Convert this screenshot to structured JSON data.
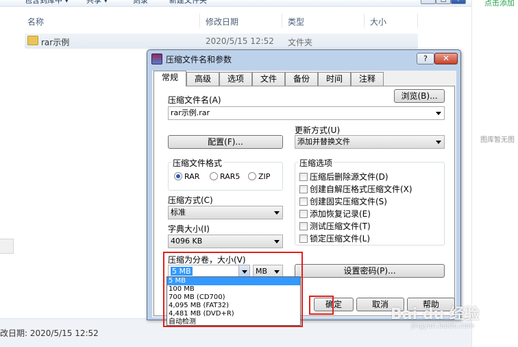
{
  "explorer": {
    "toolbar": [
      "包含到库中 ▾",
      "共享 ▾",
      "刻录",
      "新建文件夹"
    ],
    "window_controls": [
      "─",
      "□",
      "?"
    ],
    "columns": [
      "名称",
      "修改日期",
      "类型",
      "大小"
    ],
    "file": {
      "name": "rar示例",
      "modified": "2020/5/15 12:52",
      "type": "文件夹"
    },
    "status": "改日期: 2020/5/15 12:52",
    "side_texts": {
      "top": "点击添加",
      "middle": "图库暂无图"
    }
  },
  "dialog": {
    "title": "压缩文件名和参数",
    "help": "?",
    "close": "✕",
    "tabs": [
      "常规",
      "高级",
      "选项",
      "文件",
      "备份",
      "时间",
      "注释"
    ],
    "archive_name_label": "压缩文件名(A)",
    "browse_button": "浏览(B)...",
    "archive_name": "rar示例.rar",
    "profiles_button": "配置(F)...",
    "update_mode_label": "更新方式(U)",
    "update_mode": "添加并替换文件",
    "format_group": "压缩文件格式",
    "formats": [
      "RAR",
      "RAR5",
      "ZIP"
    ],
    "format_selected": "RAR",
    "method_label": "压缩方式(C)",
    "method": "标准",
    "dict_label": "字典大小(I)",
    "dict": "4096 KB",
    "options_group": "压缩选项",
    "options": [
      "压缩后删除源文件(D)",
      "创建自解压格式压缩文件(X)",
      "创建固实压缩文件(S)",
      "添加恢复记录(E)",
      "测试压缩文件(T)",
      "锁定压缩文件(L)"
    ],
    "split_label": "压缩为分卷，大小(V)",
    "split_value": "5 MB",
    "split_unit": "MB",
    "split_options": [
      "5 MB",
      "100 MB",
      "700 MB  (CD700)",
      "4,095 MB  (FAT32)",
      "4,481 MB  (DVD+R)",
      "自动检测"
    ],
    "password_button": "设置密码(P)...",
    "ok_button": "确定",
    "cancel_button": "取消",
    "help_button": "帮助"
  },
  "watermark": {
    "brand": "Bai du 经验",
    "url": "jingyan.baidu.com"
  },
  "colors": {
    "highlight": "#3399ff",
    "annotation": "#e0201d"
  }
}
